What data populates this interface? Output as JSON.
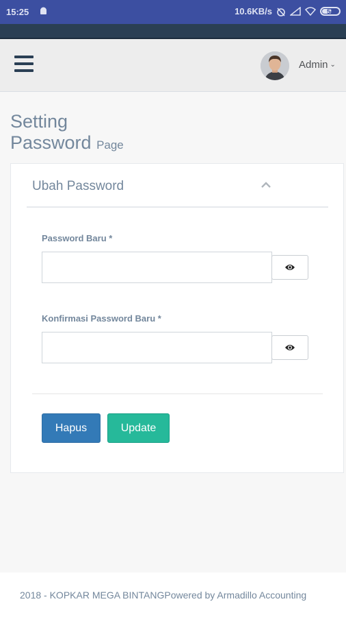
{
  "status_bar": {
    "time": "15:25",
    "network_speed": "10.6KB/s",
    "battery": "54"
  },
  "header": {
    "user_name": "Admin"
  },
  "page": {
    "title_line1": "Setting",
    "title_line2": "Password",
    "title_small": "Page"
  },
  "panel": {
    "title": "Ubah Password",
    "fields": [
      {
        "label": "Password Baru *",
        "value": "",
        "placeholder": ""
      },
      {
        "label": "Konfirmasi Password Baru *",
        "value": "",
        "placeholder": ""
      }
    ],
    "buttons": {
      "reset_label": "Hapus",
      "update_label": "Update"
    }
  },
  "footer": {
    "copyright": "2018 - KOPKAR MEGA BINTANG",
    "powered_by": "Powered by Armadillo Accounting"
  },
  "colors": {
    "status_bar": "#3c4fa1",
    "nav_dark": "#2a3f54",
    "title_text": "#73879c",
    "hapus_button": "#337ab7",
    "update_button": "#26b99a"
  },
  "icons": [
    "android-icon",
    "alarm-icon",
    "signal-icon",
    "wifi-icon",
    "battery-icon",
    "menu-icon",
    "avatar",
    "chevron-down-icon",
    "chevron-up-icon",
    "eye-icon"
  ]
}
